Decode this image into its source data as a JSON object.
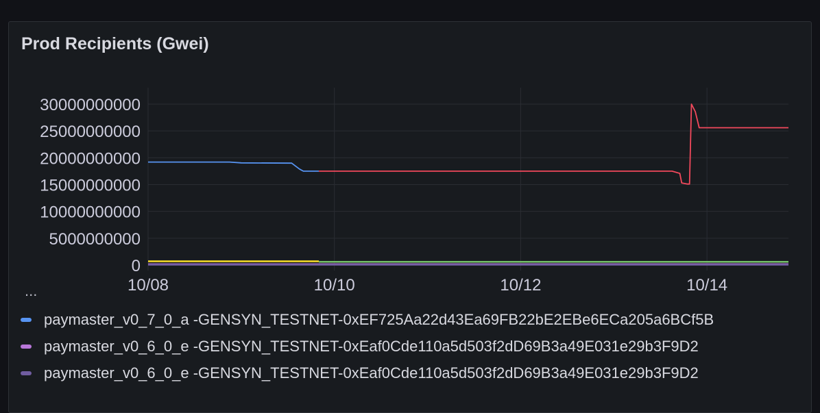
{
  "panel": {
    "title": "Prod Recipients (Gwei)"
  },
  "chart_data": {
    "type": "line",
    "title": "Prod Recipients (Gwei)",
    "xlabel": "",
    "ylabel": "",
    "ylim": [
      0,
      30000000000
    ],
    "xlim": [
      "10/08 00:00",
      "10/14 21:00"
    ],
    "grid": true,
    "y_ticks": [
      0,
      5000000000,
      10000000000,
      15000000000,
      20000000000,
      25000000000,
      30000000000
    ],
    "x_ticks": [
      "10/08",
      "10/10",
      "10/12",
      "10/14"
    ],
    "series": [
      {
        "name": "paymaster_v0_7_0_a -GENSYN_TESTNET-0xEF725Aa22d43Ea69FB22bE2EBe6ECa205a6BCf5B",
        "color": "#5794f2",
        "points": [
          [
            "10/08 00:00",
            19200000000
          ],
          [
            "10/08 21:00",
            19200000000
          ],
          [
            "10/09 00:00",
            19050000000
          ],
          [
            "10/09 13:00",
            19000000000
          ],
          [
            "10/09 15:00",
            17900000000
          ],
          [
            "10/09 16:00",
            17500000000
          ],
          [
            "10/09 20:00",
            17500000000
          ]
        ]
      },
      {
        "name": "",
        "color": "#f2495c",
        "points": [
          [
            "10/09 20:00",
            17500000000
          ],
          [
            "10/13 15:00",
            17500000000
          ],
          [
            "10/13 17:00",
            17100000000
          ],
          [
            "10/13 17:30",
            15300000000
          ],
          [
            "10/13 19:00",
            15100000000
          ],
          [
            "10/13 19:30",
            15100000000
          ],
          [
            "10/13 20:00",
            30000000000
          ],
          [
            "10/13 21:00",
            28600000000
          ],
          [
            "10/13 22:00",
            25600000000
          ],
          [
            "10/14 21:00",
            25600000000
          ]
        ]
      },
      {
        "name": "",
        "color": "#fade2a",
        "points": [
          [
            "10/08 00:00",
            700000000
          ],
          [
            "10/09 20:00",
            700000000
          ]
        ]
      },
      {
        "name": "",
        "color": "#73bf69",
        "points": [
          [
            "10/09 20:00",
            600000000
          ],
          [
            "10/14 21:00",
            600000000
          ]
        ]
      },
      {
        "name": "paymaster_v0_6_0_e -GENSYN_TESTNET-0xEaf0Cde110a5d503f2dD69B3a49E031e29b3F9D2",
        "color": "#b877d9",
        "points": [
          [
            "10/08 00:00",
            150000000
          ],
          [
            "10/14 21:00",
            150000000
          ]
        ]
      },
      {
        "name": "paymaster_v0_6_0_e -GENSYN_TESTNET-0xEaf0Cde110a5d503f2dD69B3a49E031e29b3F9D2",
        "color": "#705da0",
        "points": [
          [
            "10/08 00:00",
            60000000
          ],
          [
            "10/14 21:00",
            60000000
          ]
        ]
      }
    ]
  },
  "legend": {
    "cut_text": "...",
    "items": [
      {
        "label": "paymaster_v0_7_0_a -GENSYN_TESTNET-0xEF725Aa22d43Ea69FB22bE2EBe6ECa205a6BCf5B",
        "color": "#5794f2"
      },
      {
        "label": "paymaster_v0_6_0_e -GENSYN_TESTNET-0xEaf0Cde110a5d503f2dD69B3a49E031e29b3F9D2",
        "color": "#b877d9"
      },
      {
        "label": "paymaster_v0_6_0_e -GENSYN_TESTNET-0xEaf0Cde110a5d503f2dD69B3a49E031e29b3F9D2",
        "color": "#705da0"
      }
    ]
  }
}
